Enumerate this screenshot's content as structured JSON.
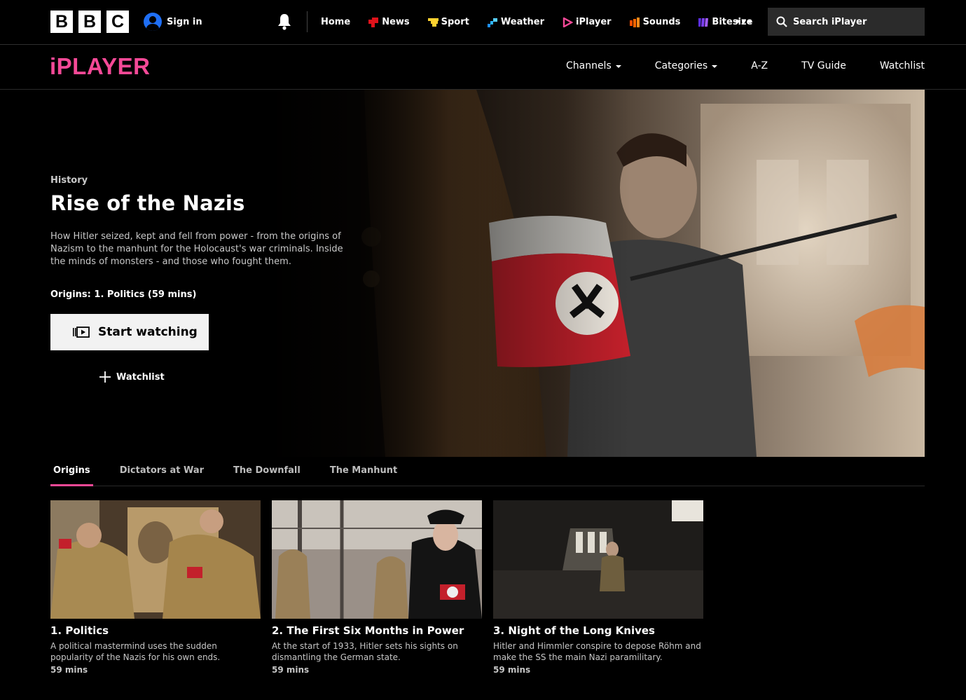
{
  "brand": {
    "letters": [
      "B",
      "B",
      "C"
    ]
  },
  "account": {
    "signin_label": "Sign in"
  },
  "topnav": [
    {
      "label": "Home",
      "icon": "",
      "color": ""
    },
    {
      "label": "News",
      "icon": "news-icon",
      "color": "#e0121b"
    },
    {
      "label": "Sport",
      "icon": "sport-icon",
      "color": "#ffd230"
    },
    {
      "label": "Weather",
      "icon": "weather-icon",
      "color": "#1e90ff"
    },
    {
      "label": "iPlayer",
      "icon": "iplayer-icon",
      "color": "#f54997"
    },
    {
      "label": "Sounds",
      "icon": "sounds-icon",
      "color": "#ff6600"
    },
    {
      "label": "Bitesize",
      "icon": "bitesize-icon",
      "color": "#7b3ff2"
    }
  ],
  "search": {
    "placeholder": "Search iPlayer"
  },
  "iplayer": {
    "logo": "iPLAYER",
    "nav": [
      {
        "label": "Channels",
        "dropdown": true
      },
      {
        "label": "Categories",
        "dropdown": true
      },
      {
        "label": "A-Z",
        "dropdown": false
      },
      {
        "label": "TV Guide",
        "dropdown": false
      },
      {
        "label": "Watchlist",
        "dropdown": false
      }
    ]
  },
  "hero": {
    "genre": "History",
    "title": "Rise of the Nazis",
    "description": "How Hitler seized, kept and fell from power - from the origins of Nazism to the manhunt for the Holocaust's war criminals. Inside the minds of monsters - and those who fought them.",
    "episode_line": "Origins: 1. Politics (59 mins)",
    "start_label": "Start watching",
    "watchlist_label": "Watchlist"
  },
  "tabs": [
    {
      "label": "Origins",
      "active": true
    },
    {
      "label": "Dictators at War",
      "active": false
    },
    {
      "label": "The Downfall",
      "active": false
    },
    {
      "label": "The Manhunt",
      "active": false
    }
  ],
  "episodes": [
    {
      "title": "1. Politics",
      "description": "A political mastermind uses the sudden popularity of the Nazis for his own ends.",
      "duration": "59 mins"
    },
    {
      "title": "2. The First Six Months in Power",
      "description": "At the start of 1933, Hitler sets his sights on dismantling the German state.",
      "duration": "59 mins"
    },
    {
      "title": "3. Night of the Long Knives",
      "description": "Hitler and Himmler conspire to depose Röhm and make the SS the main Nazi paramilitary.",
      "duration": "59 mins"
    }
  ]
}
